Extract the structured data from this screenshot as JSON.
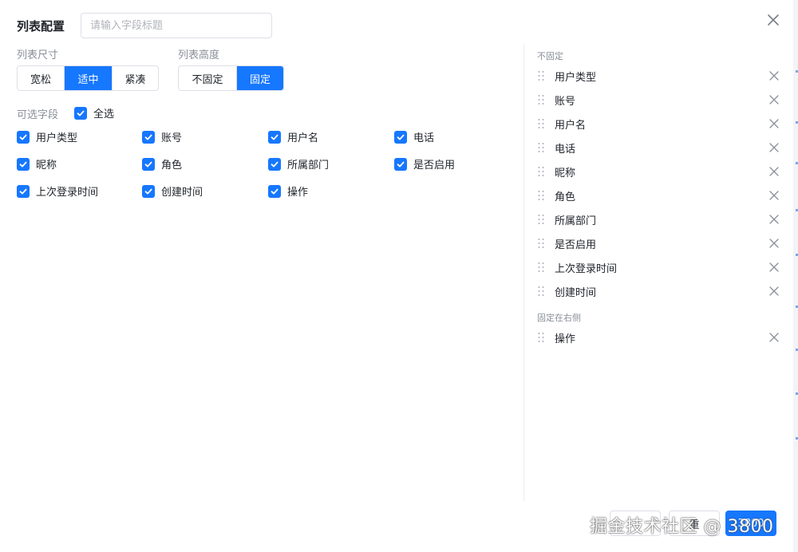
{
  "header": {
    "title": "列表配置",
    "search_placeholder": "请输入字段标题",
    "search_value": ""
  },
  "size": {
    "label": "列表尺寸",
    "options": [
      "宽松",
      "适中",
      "紧凑"
    ],
    "selected": "适中"
  },
  "height": {
    "label": "列表高度",
    "options": [
      "不固定",
      "固定"
    ],
    "selected": "固定"
  },
  "fields": {
    "label": "可选字段",
    "select_all_label": "全选",
    "select_all_checked": true,
    "items": [
      {
        "label": "用户类型",
        "checked": true
      },
      {
        "label": "账号",
        "checked": true
      },
      {
        "label": "用户名",
        "checked": true
      },
      {
        "label": "电话",
        "checked": true
      },
      {
        "label": "昵称",
        "checked": true
      },
      {
        "label": "角色",
        "checked": true
      },
      {
        "label": "所属部门",
        "checked": true
      },
      {
        "label": "是否启用",
        "checked": true
      },
      {
        "label": "上次登录时间",
        "checked": true
      },
      {
        "label": "创建时间",
        "checked": true
      },
      {
        "label": "操作",
        "checked": true
      }
    ]
  },
  "columns": {
    "unfixed_label": "不固定",
    "unfixed": [
      "用户类型",
      "账号",
      "用户名",
      "电话",
      "昵称",
      "角色",
      "所属部门",
      "是否启用",
      "上次登录时间",
      "创建时间"
    ],
    "fixed_right_label": "固定在右侧",
    "fixed_right": [
      "操作"
    ]
  },
  "footer": {
    "cancel_label": "",
    "reset_label": "重",
    "confirm_label": "3800"
  },
  "watermark": "掘金技术社区 @ 3800",
  "colors": {
    "primary": "#1677ff",
    "border": "#dcdfe6",
    "muted_text": "#8a8f99"
  }
}
